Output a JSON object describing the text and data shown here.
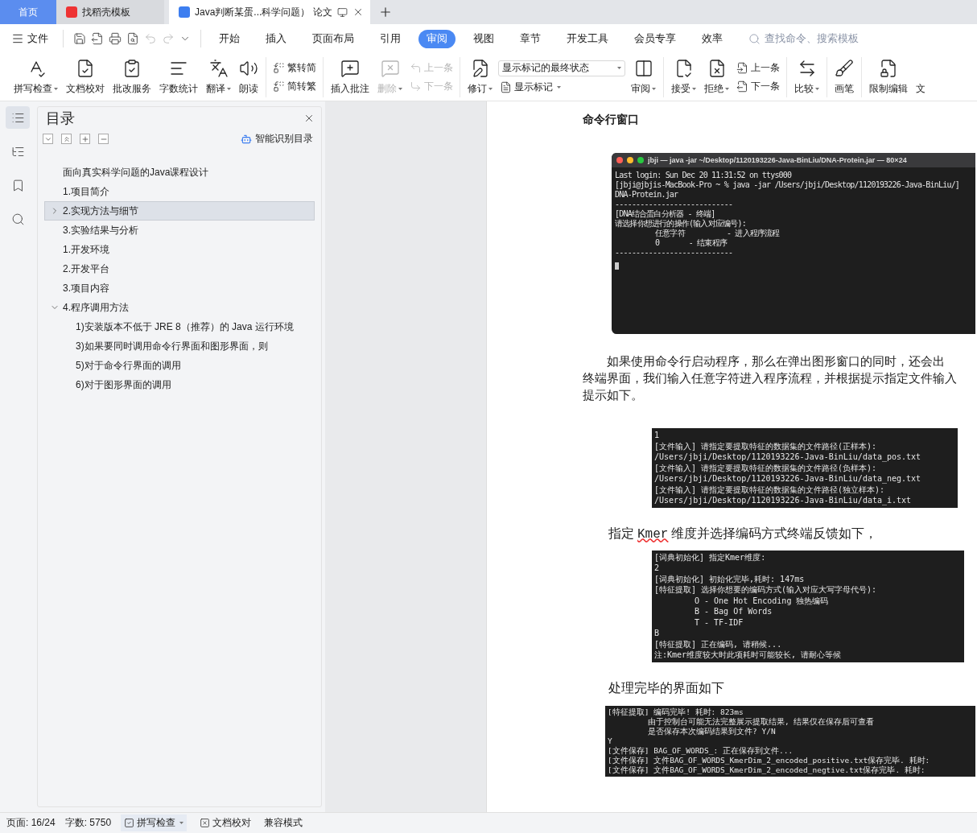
{
  "tabs": [
    {
      "kind": "home",
      "label": "首页",
      "selected": false
    },
    {
      "kind": "template",
      "label": "找稻壳模板",
      "selected": false
    },
    {
      "kind": "doc",
      "label": "Java判断某蛋...科学问题） 论文",
      "selected": true
    }
  ],
  "menu": {
    "file": "文件",
    "items": [
      {
        "label": "开始",
        "selected": false
      },
      {
        "label": "插入",
        "selected": false
      },
      {
        "label": "页面布局",
        "selected": false
      },
      {
        "label": "引用",
        "selected": false
      },
      {
        "label": "审阅",
        "selected": true
      },
      {
        "label": "视图",
        "selected": false
      },
      {
        "label": "章节",
        "selected": false
      },
      {
        "label": "开发工具",
        "selected": false
      },
      {
        "label": "会员专享",
        "selected": false
      },
      {
        "label": "效率",
        "selected": false
      }
    ],
    "search": {
      "placeholder": "查找命令、搜索模板"
    }
  },
  "ribbon": [
    {
      "items": [
        {
          "kind": "large",
          "label": "拼写检查",
          "dropdown": true,
          "disabled": false
        },
        {
          "kind": "large",
          "label": "文档校对",
          "dropdown": false,
          "disabled": false
        },
        {
          "kind": "large",
          "label": "批改服务",
          "dropdown": false,
          "disabled": false
        },
        {
          "kind": "large",
          "label": "字数统计",
          "dropdown": false,
          "disabled": false
        },
        {
          "kind": "large",
          "label": "翻译",
          "dropdown": true,
          "disabled": false
        },
        {
          "kind": "large",
          "label": "朗读",
          "dropdown": false,
          "disabled": false
        }
      ]
    },
    {
      "items": [
        {
          "kind": "pair",
          "top": {
            "label": "繁转简",
            "disabled": false
          },
          "bottom": {
            "label": "简转繁",
            "disabled": false
          }
        }
      ]
    },
    {
      "items": [
        {
          "kind": "large",
          "label": "插入批注",
          "dropdown": false,
          "disabled": false
        },
        {
          "kind": "large",
          "label": "删除",
          "dropdown": true,
          "disabled": true
        },
        {
          "kind": "pair",
          "top": {
            "label": "上一条",
            "disabled": true
          },
          "bottom": {
            "label": "下一条",
            "disabled": true
          }
        }
      ]
    },
    {
      "items": [
        {
          "kind": "large",
          "label": "修订",
          "dropdown": true,
          "disabled": false
        },
        {
          "kind": "select",
          "value": "显示标记的最终状态",
          "below": {
            "label": "显示标记",
            "dropdown": true
          }
        },
        {
          "kind": "large",
          "label": "审阅",
          "dropdown": true,
          "disabled": false
        }
      ]
    },
    {
      "items": [
        {
          "kind": "large",
          "label": "接受",
          "dropdown": true,
          "disabled": false
        },
        {
          "kind": "large",
          "label": "拒绝",
          "dropdown": true,
          "disabled": false
        },
        {
          "kind": "pair",
          "top": {
            "label": "上一条",
            "disabled": false
          },
          "bottom": {
            "label": "下一条",
            "disabled": false
          }
        }
      ]
    },
    {
      "items": [
        {
          "kind": "large",
          "label": "比较",
          "dropdown": true,
          "disabled": false
        }
      ]
    },
    {
      "items": [
        {
          "kind": "large",
          "label": "画笔",
          "dropdown": false,
          "disabled": false
        }
      ]
    },
    {
      "items": [
        {
          "kind": "large",
          "label": "限制编辑",
          "dropdown": false,
          "disabled": false
        },
        {
          "kind": "large",
          "label": "文",
          "dropdown": false,
          "disabled": false
        }
      ]
    }
  ],
  "sidebar": {
    "title": "目录",
    "smart_button": "智能识别目录",
    "toc": [
      {
        "label": "面向真实科学问题的Java课程设计",
        "selected": false
      },
      {
        "label": "1.项目简介",
        "selected": false
      },
      {
        "label": "2.实现方法与细节",
        "selected": true,
        "expanded": false
      },
      {
        "label": "3.实验结果与分析",
        "selected": false
      },
      {
        "label": "1.开发环境",
        "selected": false
      },
      {
        "label": "2.开发平台",
        "selected": false
      },
      {
        "label": "3.项目内容",
        "selected": false
      },
      {
        "label": "4.程序调用方法",
        "selected": false,
        "expanded": true,
        "children": [
          {
            "label": "1)安装版本不低于 JRE 8（推荐）的 Java 运行环境",
            "selected": false
          },
          {
            "label": "3)如果要同时调用命令行界面和图形界面，则",
            "selected": false
          },
          {
            "label": "5)对于命令行界面的调用",
            "selected": false
          },
          {
            "label": "6)对于图形界面的调用",
            "selected": false
          }
        ]
      }
    ]
  },
  "document": [
    {
      "kind": "heading",
      "text": "命令行窗口"
    },
    {
      "kind": "window_terminal",
      "title": "jbji — java -jar ~/Desktop/1120193226-Java-BinLiu/DNA-Protein.jar — 80×24",
      "cursor": true,
      "lines": [
        {
          "text": "Last login: Sun Dec 20 11:31:52 on ttys000",
          "indent": false
        },
        {
          "text": "[jbji@jbjis-MacBook-Pro ~ % java -jar /Users/jbji/Desktop/1120193226-Java-BinLiu/]",
          "indent": false
        },
        {
          "text": "DNA-Protein.jar",
          "indent": false
        },
        {
          "text": "----------------------------",
          "indent": false
        },
        {
          "text": "[DNA结合蛋白分析器 - 终端]",
          "indent": false
        },
        {
          "text": "请选择你想进行的操作(输入对应编号):",
          "indent": false
        },
        {
          "text": "任意字符          - 进入程序流程",
          "indent": true
        },
        {
          "text": "0       - 结束程序",
          "indent": true
        },
        {
          "text": "----------------------------",
          "indent": false
        }
      ]
    },
    {
      "kind": "paragraph",
      "lines": [
        "如果使用命令行启动程序，那么在弹出图形窗口的同时，还会出",
        "终端界面，我们输入任意字符进入程序流程，并根据提示指定文件输入",
        "提示如下。"
      ]
    },
    {
      "kind": "terminal",
      "cursor": false,
      "lines": [
        {
          "text": "1",
          "indent": false
        },
        {
          "text": "[文件输入] 请指定要提取特征的数据集的文件路径(正样本):",
          "indent": false
        },
        {
          "text": "/Users/jbji/Desktop/1120193226-Java-BinLiu/data_pos.txt",
          "indent": false
        },
        {
          "text": "[文件输入] 请指定要提取特征的数据集的文件路径(负样本):",
          "indent": false
        },
        {
          "text": "/Users/jbji/Desktop/1120193226-Java-BinLiu/data_neg.txt",
          "indent": false
        },
        {
          "text": "[文件输入] 请指定要提取特征的数据集的文件路径(独立样本):",
          "indent": false
        },
        {
          "text": "/Users/jbji/Desktop/1120193226-Java-BinLiu/data_i.txt",
          "indent": false
        }
      ]
    },
    {
      "kind": "sentence",
      "segments": [
        {
          "text": "指定 ",
          "misspelled": false
        },
        {
          "text": "Kmer",
          "misspelled": true
        },
        {
          "text": " 维度并选择编码方式终端反馈如下，",
          "misspelled": false
        }
      ]
    },
    {
      "kind": "terminal",
      "cursor": false,
      "lines": [
        {
          "text": "[词典初始化] 指定Kmer维度:",
          "indent": false
        },
        {
          "text": "2",
          "indent": false
        },
        {
          "text": "[词典初始化] 初始化完毕,耗时: 147ms",
          "indent": false
        },
        {
          "text": "[特征提取] 选择你想要的编码方式(输入对应大写字母代号):",
          "indent": false
        },
        {
          "text": "O - One Hot Encoding 独热编码",
          "indent": true
        },
        {
          "text": "B - Bag Of Words",
          "indent": true
        },
        {
          "text": "T - TF-IDF",
          "indent": true
        },
        {
          "text": "B",
          "indent": false
        },
        {
          "text": "[特征提取] 正在编码, 请稍候...",
          "indent": false
        },
        {
          "text": "注:Kmer维度较大时此项耗时可能较长, 请耐心等候",
          "indent": false
        }
      ]
    },
    {
      "kind": "sentence",
      "segments": [
        {
          "text": "处理完毕的界面如下",
          "misspelled": false
        }
      ]
    },
    {
      "kind": "terminal",
      "cursor": false,
      "lines": [
        {
          "text": "[特征提取] 编码完毕! 耗时: 823ms",
          "indent": false
        },
        {
          "text": "由于控制台可能无法完整展示提取结果, 结果仅在保存后可查看",
          "indent": true
        },
        {
          "text": "是否保存本次编码结果到文件? Y/N",
          "indent": true
        },
        {
          "text": "Y",
          "indent": false
        },
        {
          "text": "[文件保存] BAG_OF_WORDS_: 正在保存到文件...",
          "indent": false
        },
        {
          "text": "[文件保存] 文件BAG_OF_WORDS_KmerDim_2_encoded_positive.txt保存完毕. 耗时:",
          "indent": false
        },
        {
          "text": "[文件保存] 文件BAG_OF_WORDS_KmerDim_2_encoded_negtive.txt保存完毕. 耗时:",
          "indent": false
        }
      ]
    }
  ],
  "status_bar": {
    "page": "页面: 16/24",
    "words": "字数: 5750",
    "spell": "拼写检查",
    "proof": "文档校对",
    "mode": "兼容模式"
  }
}
